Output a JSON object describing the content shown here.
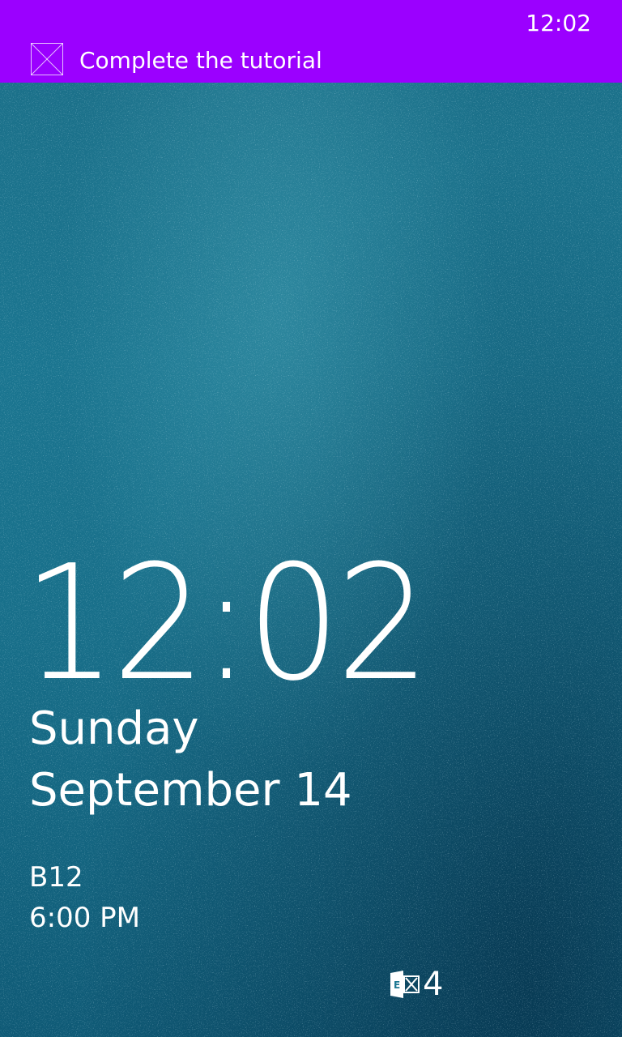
{
  "status_bar": {
    "time": "12:02",
    "accent_color": "#9b00ff"
  },
  "notification": {
    "icon": "placeholder-image-icon",
    "text": "Complete the tutorial"
  },
  "lock_screen": {
    "time": "12:02",
    "day": "Sunday",
    "date": "September 14",
    "event": {
      "title": "B12",
      "time": "6:00 PM"
    },
    "mail": {
      "icon": "exchange-mail-icon",
      "count": "4"
    },
    "background_color": "#1a7691"
  }
}
